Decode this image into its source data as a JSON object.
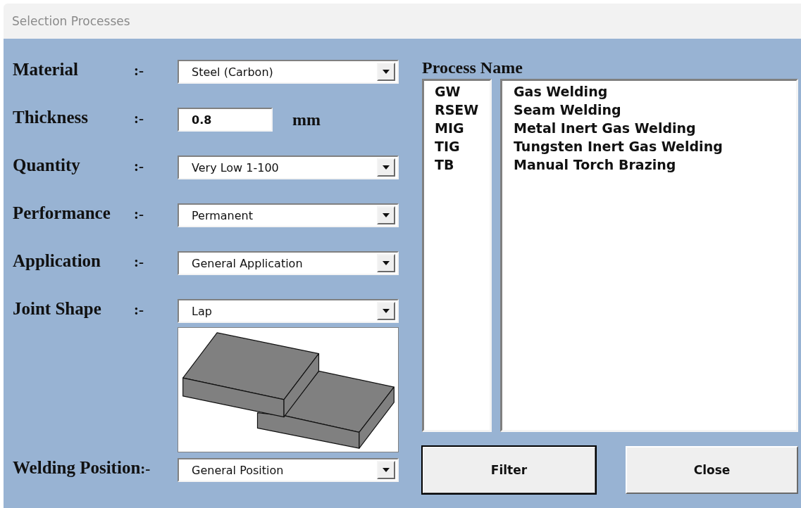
{
  "window": {
    "title": "Selection Processes"
  },
  "fields": [
    {
      "kind": "dropdown",
      "label": "Material",
      "separator": ":-",
      "value": "Steel (Carbon)"
    },
    {
      "kind": "text",
      "label": "Thickness",
      "separator": ":-",
      "value": "0.8",
      "unit": "mm"
    },
    {
      "kind": "dropdown",
      "label": "Quantity",
      "separator": ":-",
      "value": "Very Low 1-100"
    },
    {
      "kind": "dropdown",
      "label": "Performance",
      "separator": ":-",
      "value": "Permanent"
    },
    {
      "kind": "dropdown",
      "label": "Application",
      "separator": ":-",
      "value": "General Application"
    },
    {
      "kind": "dropdown",
      "label": "Joint Shape",
      "separator": ":-",
      "value": "Lap",
      "preview": true
    },
    {
      "kind": "dropdown",
      "label": "Welding Position",
      "separator": ":-",
      "value": "General Position"
    }
  ],
  "process_list": {
    "title": "Process Name",
    "rows": [
      {
        "code": "GW",
        "name": "Gas Welding"
      },
      {
        "code": "RSEW",
        "name": "Seam Welding"
      },
      {
        "code": "MIG",
        "name": "Metal Inert Gas Welding"
      },
      {
        "code": "TIG",
        "name": "Tungsten Inert Gas Welding"
      },
      {
        "code": "TB",
        "name": "Manual Torch Brazing"
      }
    ]
  },
  "buttons": [
    {
      "label": "Filter",
      "default": true
    },
    {
      "label": "Close",
      "default": false
    }
  ]
}
